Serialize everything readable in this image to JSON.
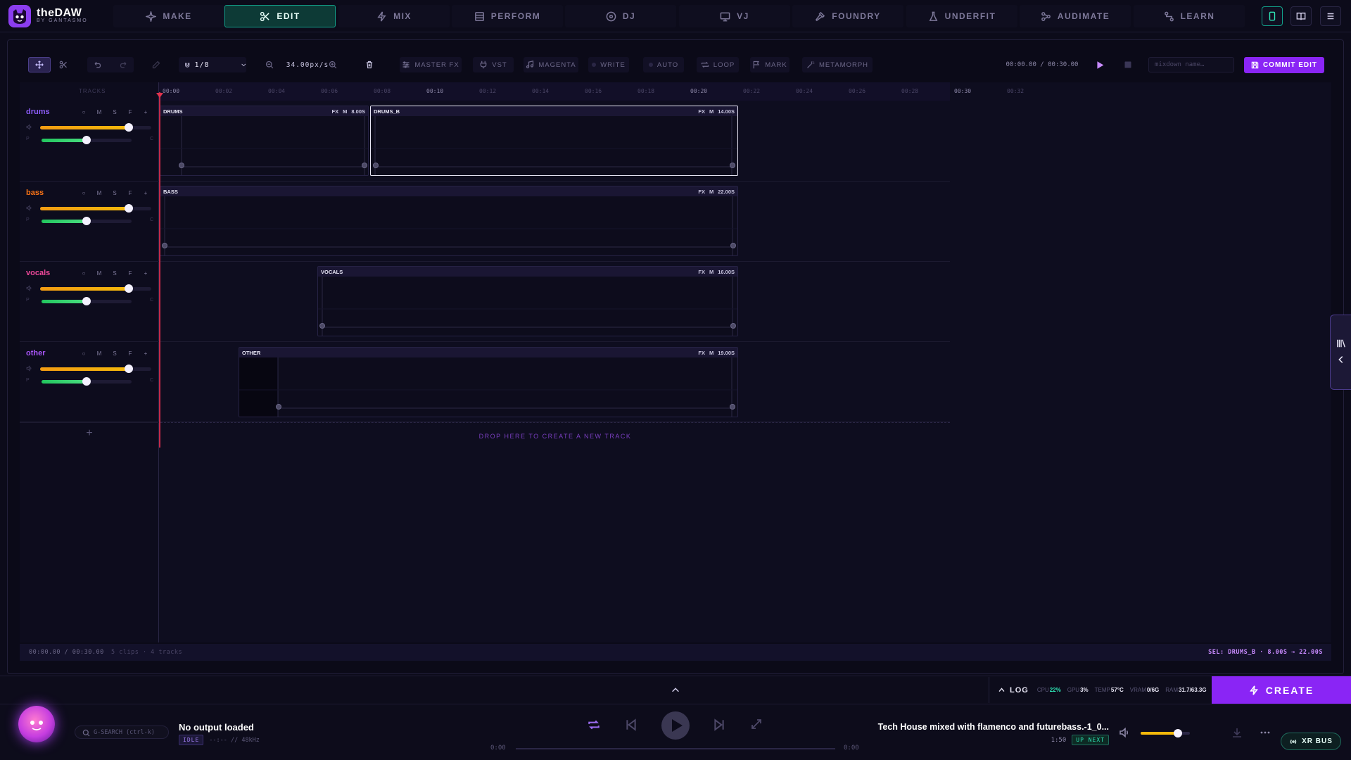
{
  "brand": {
    "name": "theDAW",
    "subtitle": "BY GANTASMO"
  },
  "nav": {
    "tabs": [
      {
        "label": "MAKE",
        "icon": "sparkle-icon"
      },
      {
        "label": "EDIT",
        "icon": "scissors-icon",
        "active": true
      },
      {
        "label": "MIX",
        "icon": "bolt-icon"
      },
      {
        "label": "PERFORM",
        "icon": "grid-icon"
      },
      {
        "label": "DJ",
        "icon": "disc-icon"
      },
      {
        "label": "VJ",
        "icon": "monitor-icon"
      },
      {
        "label": "FOUNDRY",
        "icon": "hammer-icon"
      },
      {
        "label": "UNDERFIT",
        "icon": "flask-icon"
      },
      {
        "label": "AUDIMATE",
        "icon": "nodes-icon"
      },
      {
        "label": "LEARN",
        "icon": "route-icon"
      }
    ],
    "right_icons": [
      "phone-icon",
      "book-icon",
      "menu-icon"
    ]
  },
  "toolbar": {
    "grid_value": "1/8",
    "zoom_value": "34.00px/s",
    "master_fx": "MASTER FX",
    "vst": "VST",
    "magenta": "MAGENTA",
    "write": "WRITE",
    "auto": "AUTO",
    "loop": "LOOP",
    "mark": "MARK",
    "metamorph": "METAMORPH",
    "time_display": "00:00.00 / 00:30.00",
    "mixdown_placeholder": "mixdown name…",
    "commit_label": "COMMIT EDIT"
  },
  "timeline": {
    "tracks_header": "TRACKS",
    "ticks": [
      "00:00",
      "00:02",
      "00:04",
      "00:06",
      "00:08",
      "00:10",
      "00:12",
      "00:14",
      "00:16",
      "00:18",
      "00:20",
      "00:22",
      "00:24",
      "00:26",
      "00:28",
      "00:30",
      "00:32"
    ],
    "drop_hint": "DROP HERE TO CREATE A NEW TRACK",
    "add_track": "+"
  },
  "tracks": [
    {
      "name": "drums",
      "color": "#8b5cf6",
      "controls": [
        "○",
        "M",
        "S",
        "F",
        "+"
      ],
      "volume": 0.8,
      "pan": 0.5
    },
    {
      "name": "bass",
      "color": "#f97316",
      "controls": [
        "○",
        "M",
        "S",
        "F",
        "+"
      ],
      "volume": 0.8,
      "pan": 0.5
    },
    {
      "name": "vocals",
      "color": "#ec4899",
      "controls": [
        "○",
        "M",
        "S",
        "F",
        "+"
      ],
      "volume": 0.8,
      "pan": 0.5
    },
    {
      "name": "other",
      "color": "#a855f7",
      "controls": [
        "○",
        "M",
        "S",
        "F",
        "+"
      ],
      "volume": 0.8,
      "pan": 0.5
    }
  ],
  "slider_labels": {
    "pan_left": "P",
    "pan_right": "C"
  },
  "clips": [
    {
      "name": "DRUMS",
      "fx": "FX",
      "m": "M",
      "duration": "8.00S"
    },
    {
      "name": "DRUMS_B",
      "fx": "FX",
      "m": "M",
      "duration": "14.00S",
      "selected": true
    },
    {
      "name": "BASS",
      "fx": "FX",
      "m": "M",
      "duration": "22.00S"
    },
    {
      "name": "VOCALS",
      "fx": "FX",
      "m": "M",
      "duration": "16.00S"
    },
    {
      "name": "OTHER",
      "fx": "FX",
      "m": "M",
      "duration": "19.00S"
    }
  ],
  "status": {
    "time": "00:00.00 / 00:30.00",
    "summary": "5 clips · 4 tracks",
    "selection": "SEL: DRUMS_B · 8.00S → 22.00S"
  },
  "log": {
    "label": "LOG",
    "cpu_label": "CPU",
    "cpu": "22%",
    "gpu_label": "GPU",
    "gpu": "3%",
    "temp_label": "TEMP",
    "temp": "57°C",
    "vram_label": "VRAM",
    "vram": "0/6G",
    "ram_label": "RAM",
    "ram": "31.7/63.3G"
  },
  "create_label": "CREATE",
  "player": {
    "search_placeholder": "G-SEARCH (ctrl-k)",
    "output_title": "No output loaded",
    "state_badge": "IDLE",
    "format": "--:-- // 48kHz",
    "time_start": "0:00",
    "time_end": "0:00",
    "next_title": "Tech House mixed with flamenco and futurebass.-1_0...",
    "next_duration": "1:50",
    "next_badge": "UP NEXT",
    "volume": 0.75,
    "xr_bus": "XR BUS"
  }
}
